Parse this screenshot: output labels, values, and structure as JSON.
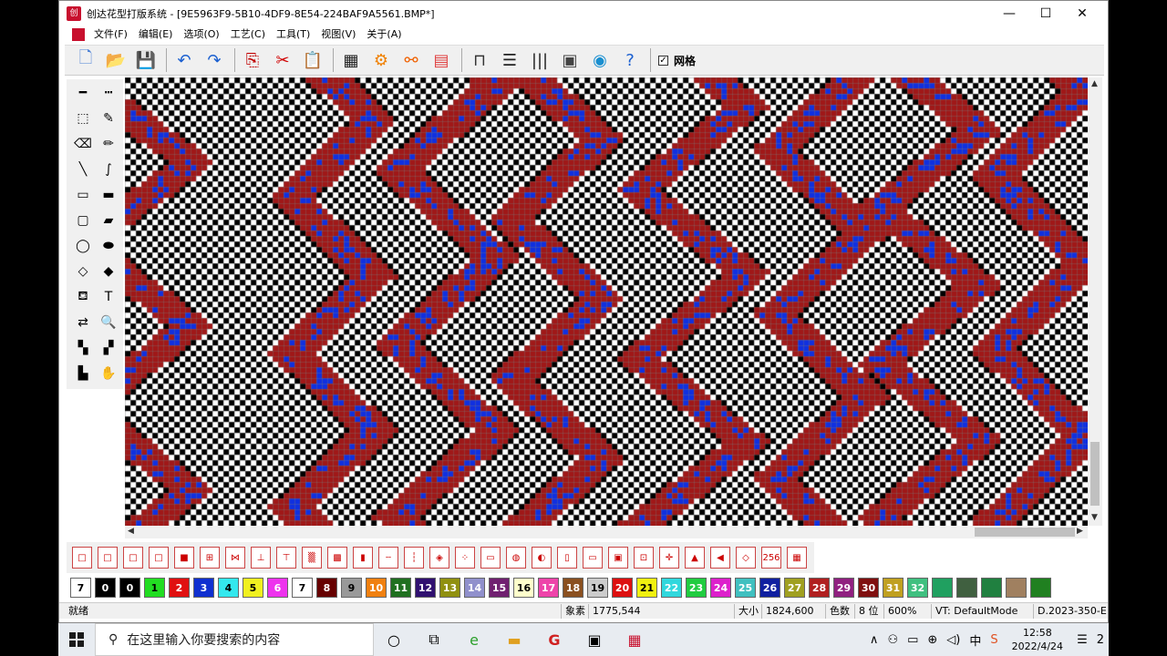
{
  "window": {
    "title": "创达花型打版系统 - [9E5963F9-5B10-4DF9-8E54-224BAF9A5561.BMP*]",
    "app_icon_text": "创",
    "buttons": {
      "minimize": "—",
      "maximize": "☐",
      "close": "✕"
    }
  },
  "menubar": {
    "items": [
      "文件(F)",
      "编辑(E)",
      "选项(O)",
      "工艺(C)",
      "工具(T)",
      "视图(V)",
      "关于(A)"
    ],
    "mdi": {
      "minimize": "–",
      "restore": "⧉",
      "close": "×"
    }
  },
  "toolbar": {
    "buttons": [
      {
        "name": "new-file",
        "glyph": "🗋",
        "color": "#4a7fd4"
      },
      {
        "name": "open-folder",
        "glyph": "📂",
        "color": "#e0a020"
      },
      {
        "name": "save",
        "glyph": "💾",
        "color": "#2d5aa0"
      },
      {
        "name": "undo",
        "glyph": "↶",
        "color": "#1a5fd0"
      },
      {
        "name": "redo",
        "glyph": "↷",
        "color": "#1a5fd0"
      },
      {
        "name": "copy",
        "glyph": "⎘",
        "color": "#c00000"
      },
      {
        "name": "cut",
        "glyph": "✂",
        "color": "#d00000"
      },
      {
        "name": "paste",
        "glyph": "📋",
        "color": "#333333"
      },
      {
        "name": "pattern-grid",
        "glyph": "▦",
        "color": "#222222"
      },
      {
        "name": "settings-gear",
        "glyph": "⚙",
        "color": "#f08000"
      },
      {
        "name": "stitch-tool",
        "glyph": "⚯",
        "color": "#f06000"
      },
      {
        "name": "color-bars",
        "glyph": "▤",
        "color": "#e04040"
      },
      {
        "name": "machine",
        "glyph": "⊓",
        "color": "#333333"
      },
      {
        "name": "list-view",
        "glyph": "☰",
        "color": "#222222"
      },
      {
        "name": "barcode",
        "glyph": "|||",
        "color": "#222222"
      },
      {
        "name": "document-grid",
        "glyph": "▣",
        "color": "#444444"
      },
      {
        "name": "eye-preview",
        "glyph": "◉",
        "color": "#1a8fd0"
      },
      {
        "name": "help",
        "glyph": "?",
        "color": "#1a5fd0"
      }
    ],
    "grid_checkbox": {
      "checked": "✓",
      "label": "网格"
    }
  },
  "left_tools": [
    {
      "name": "line-solid",
      "glyph": "━"
    },
    {
      "name": "line-dashed",
      "glyph": "┅"
    },
    {
      "name": "select-rect",
      "glyph": "⬚"
    },
    {
      "name": "eyedropper",
      "glyph": "✎"
    },
    {
      "name": "eraser",
      "glyph": "⌫"
    },
    {
      "name": "pencil",
      "glyph": "✏"
    },
    {
      "name": "line",
      "glyph": "╲"
    },
    {
      "name": "curve",
      "glyph": "∫"
    },
    {
      "name": "rect-outline",
      "glyph": "▭"
    },
    {
      "name": "rect-filled",
      "glyph": "▬"
    },
    {
      "name": "round-rect-outline",
      "glyph": "▢"
    },
    {
      "name": "round-rect-filled",
      "glyph": "▰"
    },
    {
      "name": "ellipse-outline",
      "glyph": "◯"
    },
    {
      "name": "ellipse-filled",
      "glyph": "⬬"
    },
    {
      "name": "diamond-outline",
      "glyph": "◇"
    },
    {
      "name": "diamond-filled",
      "glyph": "◆"
    },
    {
      "name": "fill-bucket",
      "glyph": "⛾"
    },
    {
      "name": "text",
      "glyph": "T"
    },
    {
      "name": "color-replace",
      "glyph": "⇄"
    },
    {
      "name": "zoom",
      "glyph": "🔍"
    },
    {
      "name": "pattern-a",
      "glyph": "▚"
    },
    {
      "name": "pattern-b",
      "glyph": "▞"
    },
    {
      "name": "pattern-c",
      "glyph": "▙"
    },
    {
      "name": "hand-pan",
      "glyph": "✋"
    }
  ],
  "bottom_tools": [
    "□",
    "□",
    "□",
    "□",
    "■",
    "⊞",
    "⋈",
    "⊥",
    "⊤",
    "▒",
    "▩",
    "▮",
    "┄",
    "┆",
    "◈",
    "⁘",
    "▭",
    "◍",
    "◐",
    "▯",
    "▭",
    "▣",
    "⊡",
    "✛",
    "▲",
    "◀",
    "◇",
    "256",
    "▦"
  ],
  "palette": [
    {
      "label": "7",
      "bg": "#ffffff",
      "fg": "#000000"
    },
    {
      "label": "0",
      "bg": "#000000",
      "fg": "#ffffff"
    },
    {
      "label": "0",
      "bg": "#000000",
      "fg": "#ffffff"
    },
    {
      "label": "1",
      "bg": "#22dd22",
      "fg": "#000000"
    },
    {
      "label": "2",
      "bg": "#e01010",
      "fg": "#ffffff"
    },
    {
      "label": "3",
      "bg": "#1030d0",
      "fg": "#ffffff"
    },
    {
      "label": "4",
      "bg": "#33e8ee",
      "fg": "#000000"
    },
    {
      "label": "5",
      "bg": "#f0f020",
      "fg": "#000000"
    },
    {
      "label": "6",
      "bg": "#ee33ee",
      "fg": "#ffffff"
    },
    {
      "label": "7",
      "bg": "#ffffff",
      "fg": "#000000"
    },
    {
      "label": "8",
      "bg": "#660000",
      "fg": "#ffffff"
    },
    {
      "label": "9",
      "bg": "#999999",
      "fg": "#000000"
    },
    {
      "label": "10",
      "bg": "#f08010",
      "fg": "#ffffff"
    },
    {
      "label": "11",
      "bg": "#207020",
      "fg": "#ffffff"
    },
    {
      "label": "12",
      "bg": "#301070",
      "fg": "#ffffff"
    },
    {
      "label": "13",
      "bg": "#909010",
      "fg": "#ffffff"
    },
    {
      "label": "14",
      "bg": "#9090cc",
      "fg": "#ffffff"
    },
    {
      "label": "15",
      "bg": "#702070",
      "fg": "#ffffff"
    },
    {
      "label": "16",
      "bg": "#ffffcc",
      "fg": "#000000"
    },
    {
      "label": "17",
      "bg": "#ee44aa",
      "fg": "#ffffff"
    },
    {
      "label": "18",
      "bg": "#8a5020",
      "fg": "#ffffff"
    },
    {
      "label": "19",
      "bg": "#cccccc",
      "fg": "#000000"
    },
    {
      "label": "20",
      "bg": "#dd1010",
      "fg": "#ffffff"
    },
    {
      "label": "21",
      "bg": "#f0f010",
      "fg": "#000000"
    },
    {
      "label": "22",
      "bg": "#30d8dd",
      "fg": "#ffffff"
    },
    {
      "label": "23",
      "bg": "#20cc40",
      "fg": "#ffffff"
    },
    {
      "label": "24",
      "bg": "#dd20cc",
      "fg": "#ffffff"
    },
    {
      "label": "25",
      "bg": "#40c0c0",
      "fg": "#ffffff"
    },
    {
      "label": "26",
      "bg": "#1020a0",
      "fg": "#ffffff"
    },
    {
      "label": "27",
      "bg": "#a0a020",
      "fg": "#ffffff"
    },
    {
      "label": "28",
      "bg": "#b02020",
      "fg": "#ffffff"
    },
    {
      "label": "29",
      "bg": "#902080",
      "fg": "#ffffff"
    },
    {
      "label": "30",
      "bg": "#801010",
      "fg": "#ffffff"
    },
    {
      "label": "31",
      "bg": "#c0a020",
      "fg": "#ffffff"
    },
    {
      "label": "32",
      "bg": "#40c080",
      "fg": "#ffffff"
    },
    {
      "label": "",
      "bg": "#20a060",
      "fg": "#ffffff"
    },
    {
      "label": "",
      "bg": "#406040",
      "fg": "#ffffff"
    },
    {
      "label": "",
      "bg": "#208040",
      "fg": "#ffffff"
    },
    {
      "label": "",
      "bg": "#a08060",
      "fg": "#ffffff"
    },
    {
      "label": "",
      "bg": "#208020",
      "fg": "#ffffff"
    }
  ],
  "status": {
    "ready": "就绪",
    "pixel_label": "象素",
    "pixel_value": "1775,544",
    "size_label": "大小",
    "size_value": "1824,600",
    "colors_label": "色数",
    "colors_value": "8 位",
    "zoom": "600%",
    "vt": "VT: DefaultMode",
    "version": "D.2023-350-E"
  },
  "taskbar": {
    "search_placeholder": "在这里输入你要搜索的内容",
    "time": "12:58",
    "date": "2022/4/24",
    "ime": "中",
    "notification": "2"
  },
  "pattern_colors": {
    "red": "#a01818",
    "blue": "#1030e0",
    "black": "#000000",
    "white": "#ffffff"
  }
}
